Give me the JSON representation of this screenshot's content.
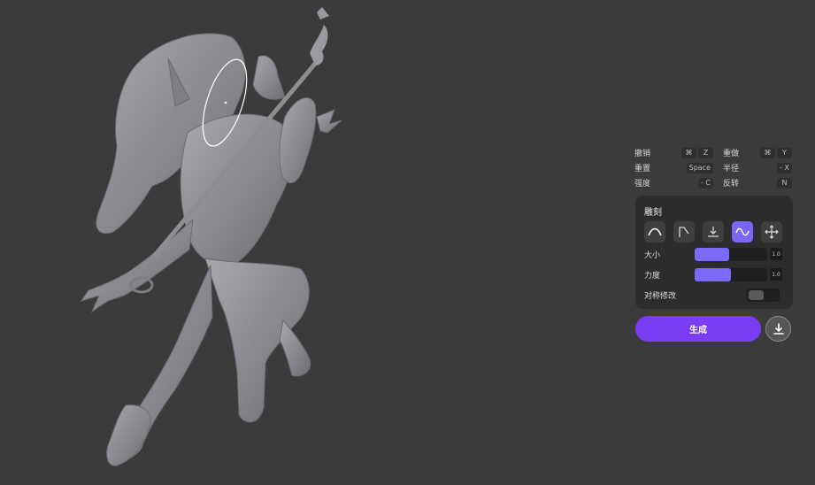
{
  "shortcuts": {
    "rows": [
      {
        "left": {
          "label": "撤销",
          "keys": [
            "⌘",
            "Z"
          ]
        },
        "right": {
          "label": "重做",
          "keys": [
            "⌘",
            "Y"
          ]
        }
      },
      {
        "left": {
          "label": "重置",
          "keys": [
            "Space"
          ]
        },
        "right": {
          "label": "半径",
          "keys": [
            "- X"
          ]
        }
      },
      {
        "left": {
          "label": "强度",
          "keys": [
            "- C"
          ]
        },
        "right": {
          "label": "反转",
          "keys": [
            "N"
          ]
        }
      }
    ]
  },
  "sculpt_panel": {
    "title": "雕刻",
    "tools": [
      {
        "icon": "smooth-curve-icon",
        "active": false
      },
      {
        "icon": "flatten-angle-icon",
        "active": false
      },
      {
        "icon": "push-down-icon",
        "active": false
      },
      {
        "icon": "wave-icon",
        "active": true
      },
      {
        "icon": "move-arrows-icon",
        "active": false
      }
    ],
    "size": {
      "label": "大小",
      "value": "1.0",
      "fill_fraction": 0.48
    },
    "strength": {
      "label": "力度",
      "value": "1.0",
      "fill_fraction": 0.5
    },
    "symmetry": {
      "label": "对称修改",
      "enabled": false
    }
  },
  "actions": {
    "generate_label": "生成",
    "download_icon": "download-icon"
  },
  "colors": {
    "background": "#3b3b3b",
    "panel": "#2c2c2c",
    "accent": "#7866f5",
    "generate_button": "#7b3df1"
  }
}
